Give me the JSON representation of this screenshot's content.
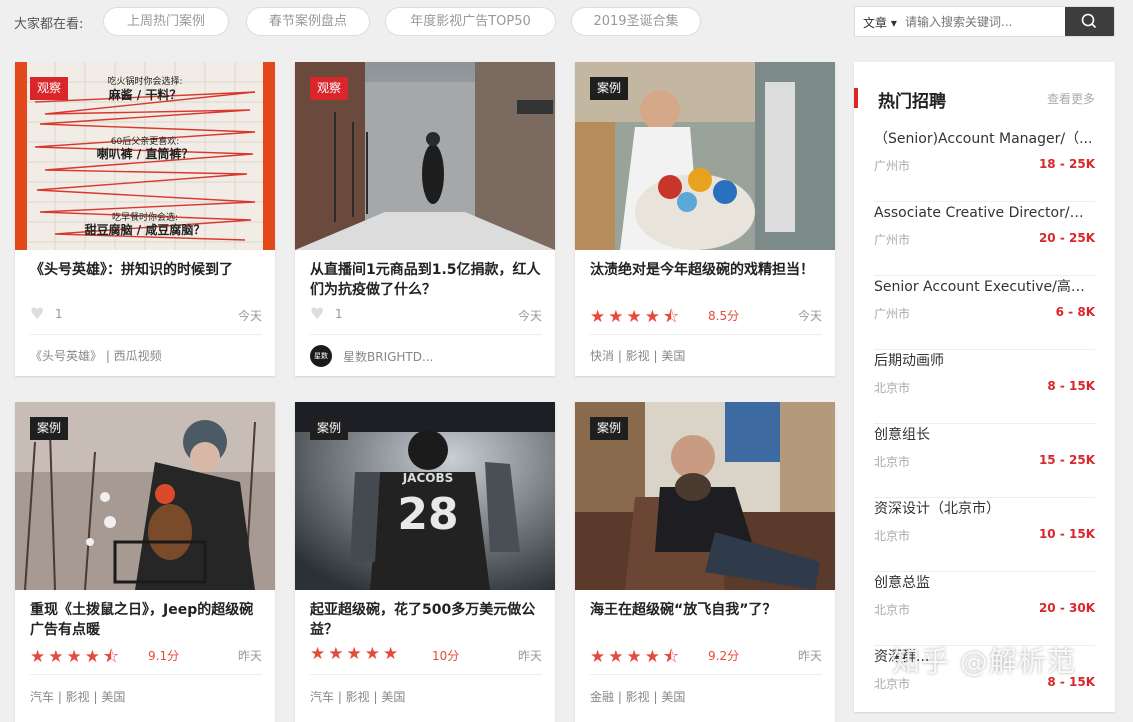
{
  "topbar": {
    "label": "大家都在看:",
    "pills": [
      "上周热门案例",
      "春节案例盘点",
      "年度影视广告TOP50",
      "2019圣诞合集"
    ],
    "search": {
      "type": "文章",
      "placeholder": "请输入搜索关键词..."
    }
  },
  "cards": [
    {
      "tag": "观察",
      "title": "《头号英雄》：拼知识的时候到了",
      "likes": "1",
      "date": "今天",
      "foot": "《头号英雄》 | 西瓜视频",
      "img_text": [
        "吃火锅时你会选择:",
        "麻酱 / 干料？",
        "60后父亲更喜欢:",
        "喇叭裤 / 直筒裤？",
        "吃早餐时你会选:",
        "甜豆腐脑 / 咸豆腐脑？"
      ]
    },
    {
      "tag": "观察",
      "title": "从直播间1元商品到1.5亿捐款，红人们为抗疫做了什么？",
      "likes": "1",
      "date": "今天",
      "foot": "星数BRIGHTD...",
      "avatar_text": "星数"
    },
    {
      "tag": "案例",
      "title": "汰渍绝对是今年超级碗的戏精担当！",
      "stars": "★★★★⯪",
      "rating": 4.5,
      "score": "8.5分",
      "date": "今天",
      "foot": "快消 | 影视 | 美国"
    },
    {
      "tag": "案例",
      "title": "重现《土拨鼠之日》，Jeep的超级碗广告有点暖",
      "stars": "★★★★⯪",
      "rating": 4.5,
      "score": "9.1分",
      "date": "昨天",
      "foot": "汽车 | 影视 | 美国"
    },
    {
      "tag": "案例",
      "title": "起亚超级碗，花了500多万美元做公益？",
      "stars": "★★★★★",
      "rating": 5,
      "score": "10分",
      "date": "昨天",
      "foot": "汽车 | 影视 | 美国",
      "img_text": [
        "JACOBS",
        "28"
      ]
    },
    {
      "tag": "案例",
      "title": "海王在超级碗“放飞自我”了？",
      "stars": "★★★★⯪",
      "rating": 4.5,
      "score": "9.2分",
      "date": "昨天",
      "foot": "金融 | 影视 | 美国"
    }
  ],
  "sidebar": {
    "title": "热门招聘",
    "more": "查看更多",
    "jobs": [
      {
        "title": "（Senior)Account Manager/（...",
        "city": "广州市",
        "salary": "18 - 25K"
      },
      {
        "title": "Associate Creative Director/创...",
        "city": "广州市",
        "salary": "20 - 25K"
      },
      {
        "title": "Senior Account Executive/高级...",
        "city": "广州市",
        "salary": "6 - 8K"
      },
      {
        "title": "后期动画师",
        "city": "北京市",
        "salary": "8 - 15K"
      },
      {
        "title": "创意组长",
        "city": "北京市",
        "salary": "15 - 25K"
      },
      {
        "title": "资深设计（北京市）",
        "city": "北京市",
        "salary": "10 - 15K"
      },
      {
        "title": "创意总监",
        "city": "北京市",
        "salary": "20 - 30K"
      },
      {
        "title": "资深群...",
        "city": "北京市",
        "salary": "8 - 15K"
      }
    ]
  },
  "watermark": "知乎 @解析范",
  "colors": {
    "accent": "#d8262a",
    "star": "#e64a3b",
    "search_btn": "#3d3d3d"
  }
}
